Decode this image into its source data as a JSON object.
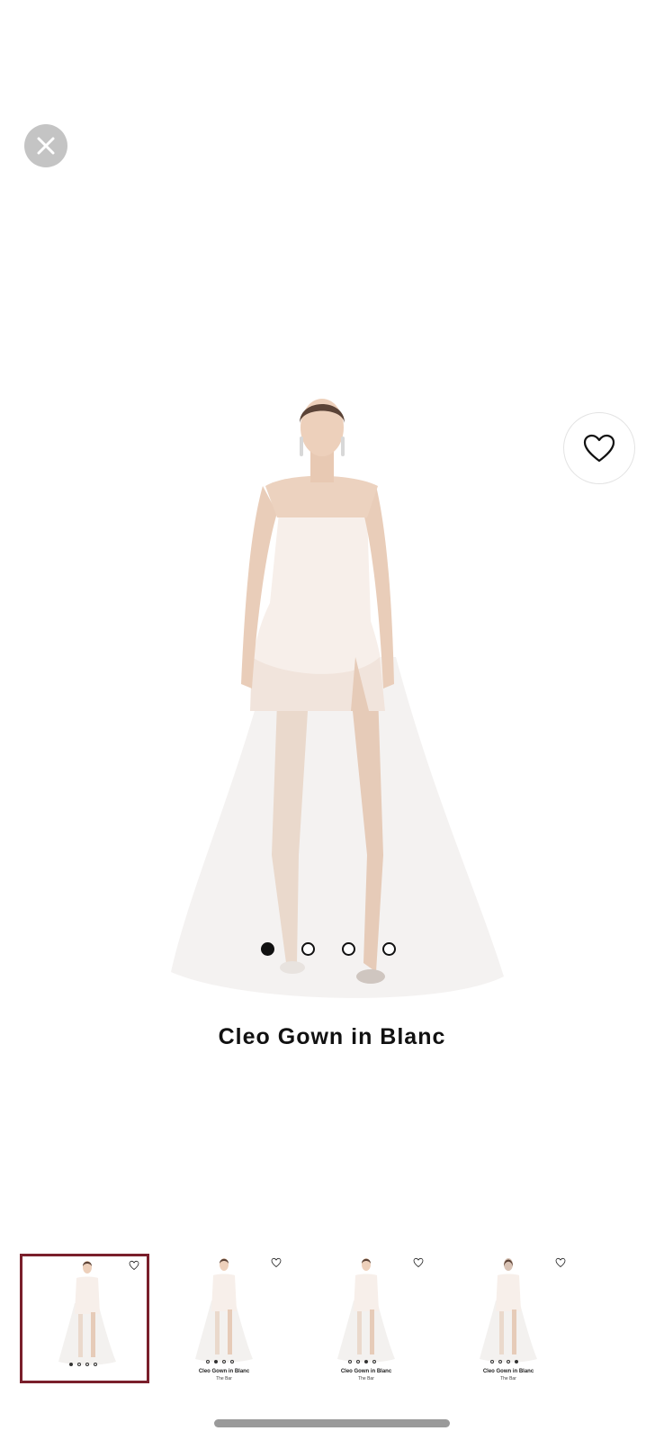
{
  "product": {
    "title": "Cleo Gown in Blanc",
    "image_alt": "Model wearing white strapless tulle gown"
  },
  "buttons": {
    "close_icon": "close-icon",
    "wishlist_icon": "heart-icon"
  },
  "carousel": {
    "total": 4,
    "active_index": 0
  },
  "thumbnails": [
    {
      "title": "",
      "brand": "",
      "selected": true,
      "active_dot": 0
    },
    {
      "title": "Cleo Gown in Blanc",
      "brand": "The Bar",
      "selected": false,
      "active_dot": 1
    },
    {
      "title": "Cleo Gown in Blanc",
      "brand": "The Bar",
      "selected": false,
      "active_dot": 2
    },
    {
      "title": "Cleo Gown in Blanc",
      "brand": "The Bar",
      "selected": false,
      "active_dot": 3
    }
  ],
  "colors": {
    "selected_border": "#7a1f2b",
    "close_bg": "#c4c4c4",
    "home_indicator": "#9a9a9a"
  }
}
